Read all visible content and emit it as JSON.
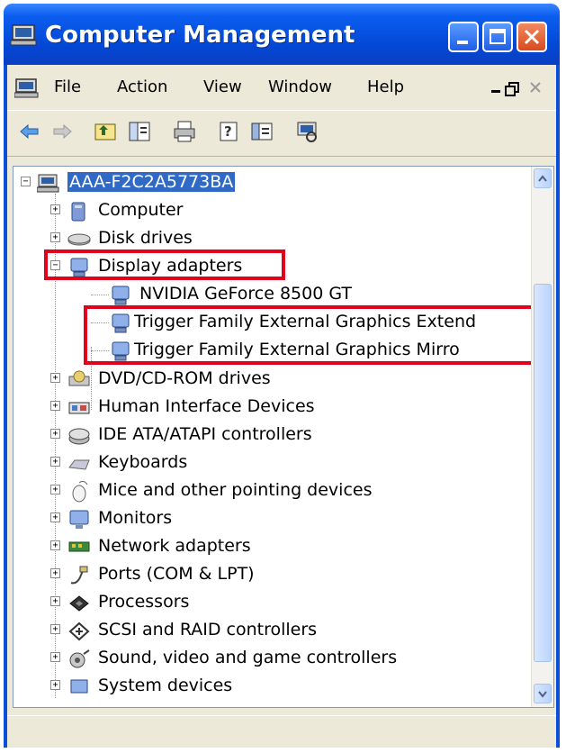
{
  "window": {
    "title": "Computer Management"
  },
  "menu": {
    "items": [
      "File",
      "Action",
      "View",
      "Window",
      "Help"
    ]
  },
  "toolbar": {
    "icons": [
      "back-icon",
      "forward-icon",
      "up-icon",
      "show-hide-tree-icon",
      "print-icon",
      "help-icon",
      "properties-icon",
      "computer-scan-icon"
    ]
  },
  "tree": {
    "root": "AAA-F2C2A5773BA",
    "items": [
      {
        "label": "Computer",
        "icon": "computer-icon",
        "expanded": false
      },
      {
        "label": "Disk drives",
        "icon": "disk-drive-icon",
        "expanded": false
      },
      {
        "label": "Display adapters",
        "icon": "display-adapter-icon",
        "expanded": true
      },
      {
        "label": "NVIDIA GeForce 8500 GT",
        "icon": "display-adapter-icon",
        "child": true
      },
      {
        "label": "Trigger Family External Graphics Extend",
        "icon": "display-adapter-icon",
        "child": true
      },
      {
        "label": "Trigger Family External Graphics Mirro",
        "icon": "display-adapter-icon",
        "child": true
      },
      {
        "label": "DVD/CD-ROM drives",
        "icon": "dvd-drive-icon",
        "expanded": false
      },
      {
        "label": "Human Interface Devices",
        "icon": "hid-icon",
        "expanded": false
      },
      {
        "label": "IDE ATA/ATAPI controllers",
        "icon": "ide-controller-icon",
        "expanded": false
      },
      {
        "label": "Keyboards",
        "icon": "keyboard-icon",
        "expanded": false
      },
      {
        "label": "Mice and other pointing devices",
        "icon": "mouse-icon",
        "expanded": false
      },
      {
        "label": "Monitors",
        "icon": "monitor-icon",
        "expanded": false
      },
      {
        "label": "Network adapters",
        "icon": "network-adapter-icon",
        "expanded": false
      },
      {
        "label": "Ports (COM & LPT)",
        "icon": "port-icon",
        "expanded": false
      },
      {
        "label": "Processors",
        "icon": "processor-icon",
        "expanded": false
      },
      {
        "label": "SCSI and RAID controllers",
        "icon": "scsi-controller-icon",
        "expanded": false
      },
      {
        "label": "Sound, video and game controllers",
        "icon": "sound-icon",
        "expanded": false
      },
      {
        "label": "System devices",
        "icon": "system-device-icon",
        "expanded": false
      }
    ]
  },
  "colors": {
    "title_bar": "#0447d4",
    "selection": "#316ac5",
    "highlight_box": "#e3001b"
  }
}
